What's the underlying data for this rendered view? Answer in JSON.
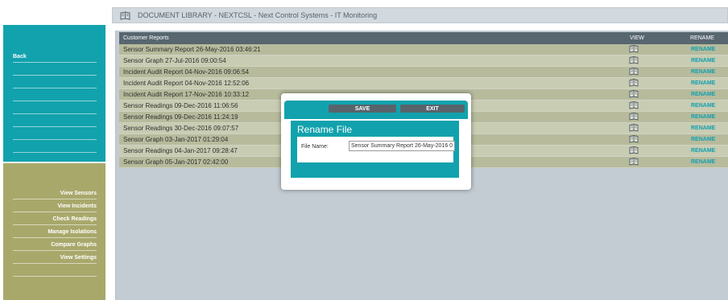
{
  "header": {
    "title": "DOCUMENT LIBRARY   -   NEXTCSL - Next Control Systems - IT Monitoring",
    "icon": "book-icon"
  },
  "sidebar_top": {
    "items": [
      "Back",
      "",
      "",
      "",
      "",
      "",
      "",
      ""
    ]
  },
  "sidebar_bottom": {
    "items": [
      "View Sensors",
      "View Incidents",
      "Check Readings",
      "Manage Isolations",
      "Compare Graphs",
      "View Settings",
      ""
    ]
  },
  "table": {
    "columns": {
      "name": "Customer Reports",
      "view": "VIEW",
      "rename": "RENAME"
    },
    "rows": [
      {
        "name": "Sensor Summary Report 26-May-2016 03:46:21",
        "rename": "RENAME"
      },
      {
        "name": "Sensor Graph 27-Jul-2016 09:00:54",
        "rename": "RENAME"
      },
      {
        "name": "Incident Audit Report 04-Nov-2016 09:06:54",
        "rename": "RENAME"
      },
      {
        "name": "Incident Audit Report 04-Nov-2016 12:52:06",
        "rename": "RENAME"
      },
      {
        "name": "Incident Audit Report 17-Nov-2016 10:33:12",
        "rename": "RENAME"
      },
      {
        "name": "Sensor Readings 09-Dec-2016 11:06:56",
        "rename": "RENAME"
      },
      {
        "name": "Sensor Readings 09-Dec-2016 11:24:19",
        "rename": "RENAME"
      },
      {
        "name": "Sensor Readings 30-Dec-2016 09:07:57",
        "rename": "RENAME"
      },
      {
        "name": "Sensor Graph 03-Jan-2017 01:29:04",
        "rename": "RENAME"
      },
      {
        "name": "Sensor Readings 04-Jan-2017 09:28:47",
        "rename": "RENAME"
      },
      {
        "name": "Sensor Graph 05-Jan-2017 02:42:00",
        "rename": "RENAME"
      }
    ]
  },
  "modal": {
    "save_label": "SAVE",
    "exit_label": "EXIT",
    "title": "Rename File",
    "field_label": "File Name:",
    "field_value": "Sensor Summary Report 26-May-2016 0"
  },
  "colors": {
    "teal": "#12a2ad",
    "olive": "#a8a86b",
    "header_dark": "#57666f",
    "link": "#11a0b0"
  }
}
